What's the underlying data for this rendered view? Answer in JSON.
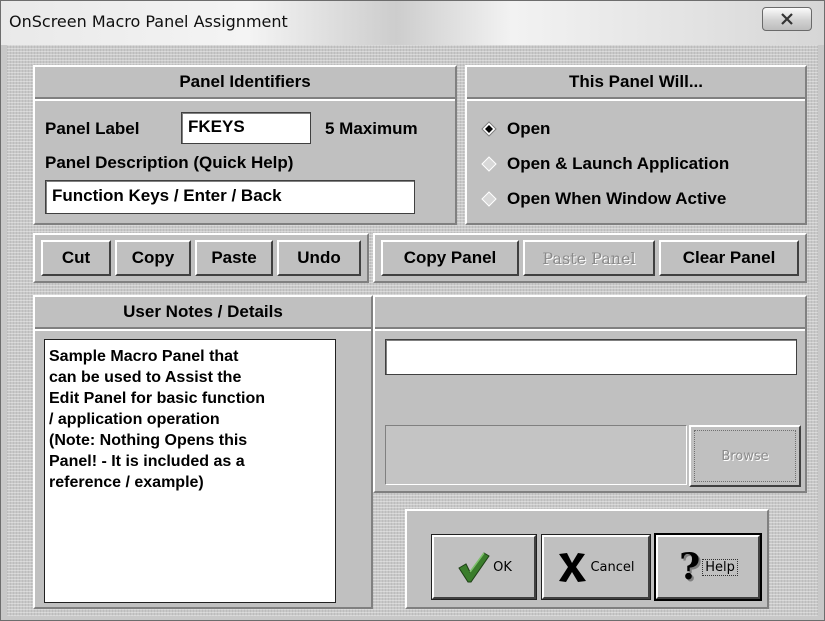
{
  "window": {
    "title": "OnScreen Macro Panel Assignment",
    "close_label": "X"
  },
  "identifiers": {
    "header": "Panel Identifiers",
    "panel_label_caption": "Panel Label",
    "panel_label_value": "FKEYS",
    "max_note": "5 Maximum",
    "description_caption": "Panel Description (Quick Help)",
    "description_value": "Function Keys / Enter / Back"
  },
  "behavior": {
    "header": "This Panel Will...",
    "options": [
      {
        "label": "Open",
        "selected": true
      },
      {
        "label": "Open & Launch Application",
        "selected": false
      },
      {
        "label": "Open When Window Active",
        "selected": false
      }
    ]
  },
  "edit_buttons": {
    "cut": "Cut",
    "copy": "Copy",
    "paste": "Paste",
    "undo": "Undo"
  },
  "panel_buttons": {
    "copy_panel": "Copy Panel",
    "paste_panel": "Paste Panel",
    "clear_panel": "Clear Panel"
  },
  "notes": {
    "header": "User Notes / Details",
    "lines": [
      "Sample Macro Panel that",
      "can be used to Assist the",
      "Edit Panel for basic function",
      "/ application operation",
      "(Note: Nothing Opens this",
      "Panel! - It is included as a",
      "reference / example)"
    ]
  },
  "launch": {
    "path_value": "",
    "browse_label": "Browse"
  },
  "dialog_buttons": {
    "ok": "OK",
    "cancel": "Cancel",
    "help": "Help"
  },
  "colors": {
    "face": "#c0c0c0",
    "check_green": "#3a7d2b",
    "cancel_black": "#000000"
  }
}
